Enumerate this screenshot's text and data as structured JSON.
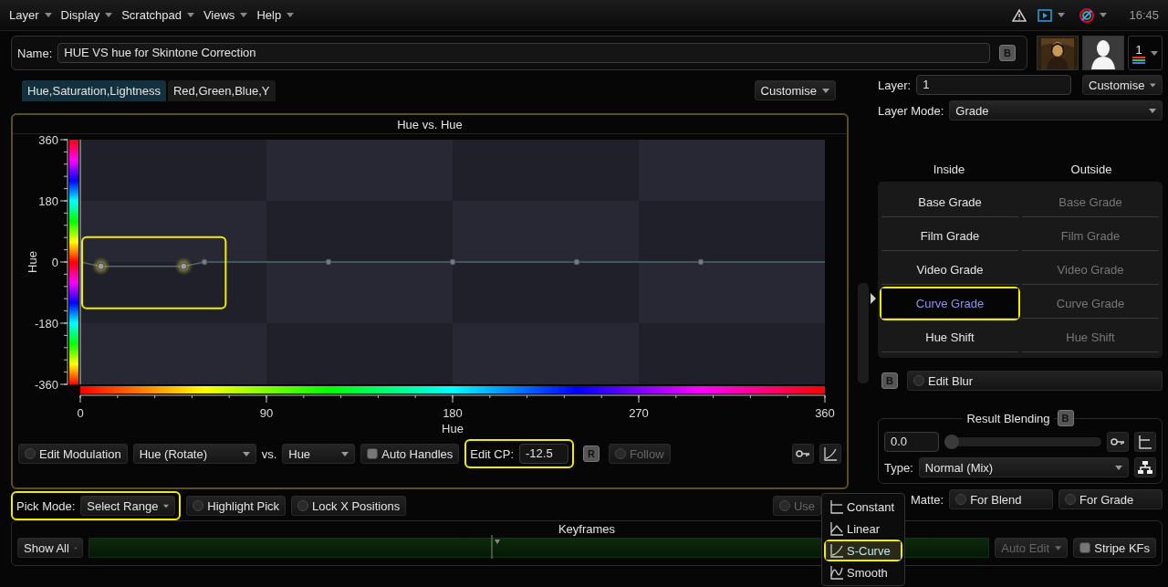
{
  "menu_bar": {
    "menus": [
      "Layer",
      "Display",
      "Scratchpad",
      "Views",
      "Help"
    ],
    "clock": "16:45"
  },
  "name_bar": {
    "label": "Name:",
    "value": "HUE VS hue for Skintone Correction",
    "button": "B"
  },
  "layer_thumbs": {
    "count": "1"
  },
  "tabs": [
    {
      "label": "Hue,Saturation,Lightness",
      "selected": true
    },
    {
      "label": "Red,Green,Blue,Y",
      "selected": false
    }
  ],
  "customise": "Customise",
  "graph": {
    "chart_data": {
      "type": "line",
      "title": "Hue vs. Hue",
      "xlabel": "Hue",
      "ylabel": "Hue",
      "x": [
        0,
        10,
        50,
        60,
        120,
        180,
        240,
        300,
        360
      ],
      "series": [
        {
          "color": "#4f6a6c",
          "values": [
            0,
            -12.5,
            -12.5,
            0,
            0,
            0,
            0,
            0,
            0
          ]
        }
      ],
      "xlim": [
        0,
        360
      ],
      "ylim": [
        -360,
        360
      ],
      "xticks": [
        0,
        90,
        180,
        270,
        360
      ],
      "yticks": [
        360,
        180,
        0,
        -180,
        -360
      ]
    },
    "highlighted": true,
    "control_points": [
      {
        "selected": true
      },
      {
        "selected": true
      },
      {
        "selected": false
      },
      {
        "selected": false
      },
      {
        "selected": false
      },
      {
        "selected": false
      },
      {
        "selected": false
      }
    ]
  },
  "controls": {
    "edit_modulation": {
      "label": "Edit Modulation",
      "on": false
    },
    "mod_type": "Hue (Rotate)",
    "vs": "vs.",
    "vs_type": "Hue",
    "auto_handles": {
      "label": "Auto Handles",
      "checked": false
    },
    "edit_cp": {
      "label": "Edit CP:",
      "value": "-12.5",
      "highlighted": true
    },
    "reset_button": "R",
    "follow": {
      "label": "Follow",
      "on": false,
      "disabled": true
    }
  },
  "pick_row": {
    "pick_mode": {
      "label": "Pick Mode:",
      "value": "Select Range",
      "highlighted": true
    },
    "toggles": [
      {
        "label": "Highlight Pick",
        "on": false
      },
      {
        "label": "Lock X Positions",
        "on": false
      }
    ],
    "use": {
      "label": "Use",
      "disabled": true
    }
  },
  "keyframes": {
    "title": "Keyframes",
    "filter": "Show All",
    "auto_edit": {
      "label": "Auto Edit",
      "disabled": true
    },
    "stripe": {
      "label": "Stripe KFs",
      "checked": false
    }
  },
  "interp_menu": [
    {
      "label": "Constant",
      "kind": "constant",
      "selected": false,
      "highlighted": false
    },
    {
      "label": "Linear",
      "kind": "linear",
      "selected": false,
      "highlighted": false
    },
    {
      "label": "S-Curve",
      "kind": "scurve",
      "selected": true,
      "highlighted": true
    },
    {
      "label": "Smooth",
      "kind": "smooth",
      "selected": false,
      "highlighted": false
    }
  ],
  "layer_panel": {
    "layer_label": "Layer:",
    "layer_value": "1",
    "customise": "Customise",
    "mode_label": "Layer Mode:",
    "mode_value": "Grade"
  },
  "grades": [
    {
      "title": "Inside",
      "disabled": false,
      "items": [
        {
          "label": "Base Grade",
          "selected": false,
          "highlighted": false
        },
        {
          "label": "Film Grade",
          "selected": false,
          "highlighted": false
        },
        {
          "label": "Video Grade",
          "selected": false,
          "highlighted": false
        },
        {
          "label": "Curve Grade",
          "selected": true,
          "highlighted": true
        },
        {
          "label": "Hue Shift",
          "selected": false,
          "highlighted": false
        }
      ]
    },
    {
      "title": "Outside",
      "disabled": true,
      "items": [
        {
          "label": "Base Grade",
          "selected": false,
          "highlighted": false
        },
        {
          "label": "Film Grade",
          "selected": false,
          "highlighted": false
        },
        {
          "label": "Video Grade",
          "selected": false,
          "highlighted": false
        },
        {
          "label": "Curve Grade",
          "selected": false,
          "highlighted": false
        },
        {
          "label": "Hue Shift",
          "selected": false,
          "highlighted": false
        }
      ]
    }
  ],
  "edit_blur": {
    "button": "B",
    "label": "Edit Blur",
    "on": false
  },
  "result_blending": {
    "title": "Result Blending",
    "button": "B",
    "value": "0.0",
    "level": 0,
    "type_label": "Type:",
    "type_value": "Normal (Mix)"
  },
  "matte": {
    "label": "Matte:",
    "options": [
      {
        "label": "For Blend",
        "on": false
      },
      {
        "label": "For Grade",
        "on": false
      }
    ]
  }
}
